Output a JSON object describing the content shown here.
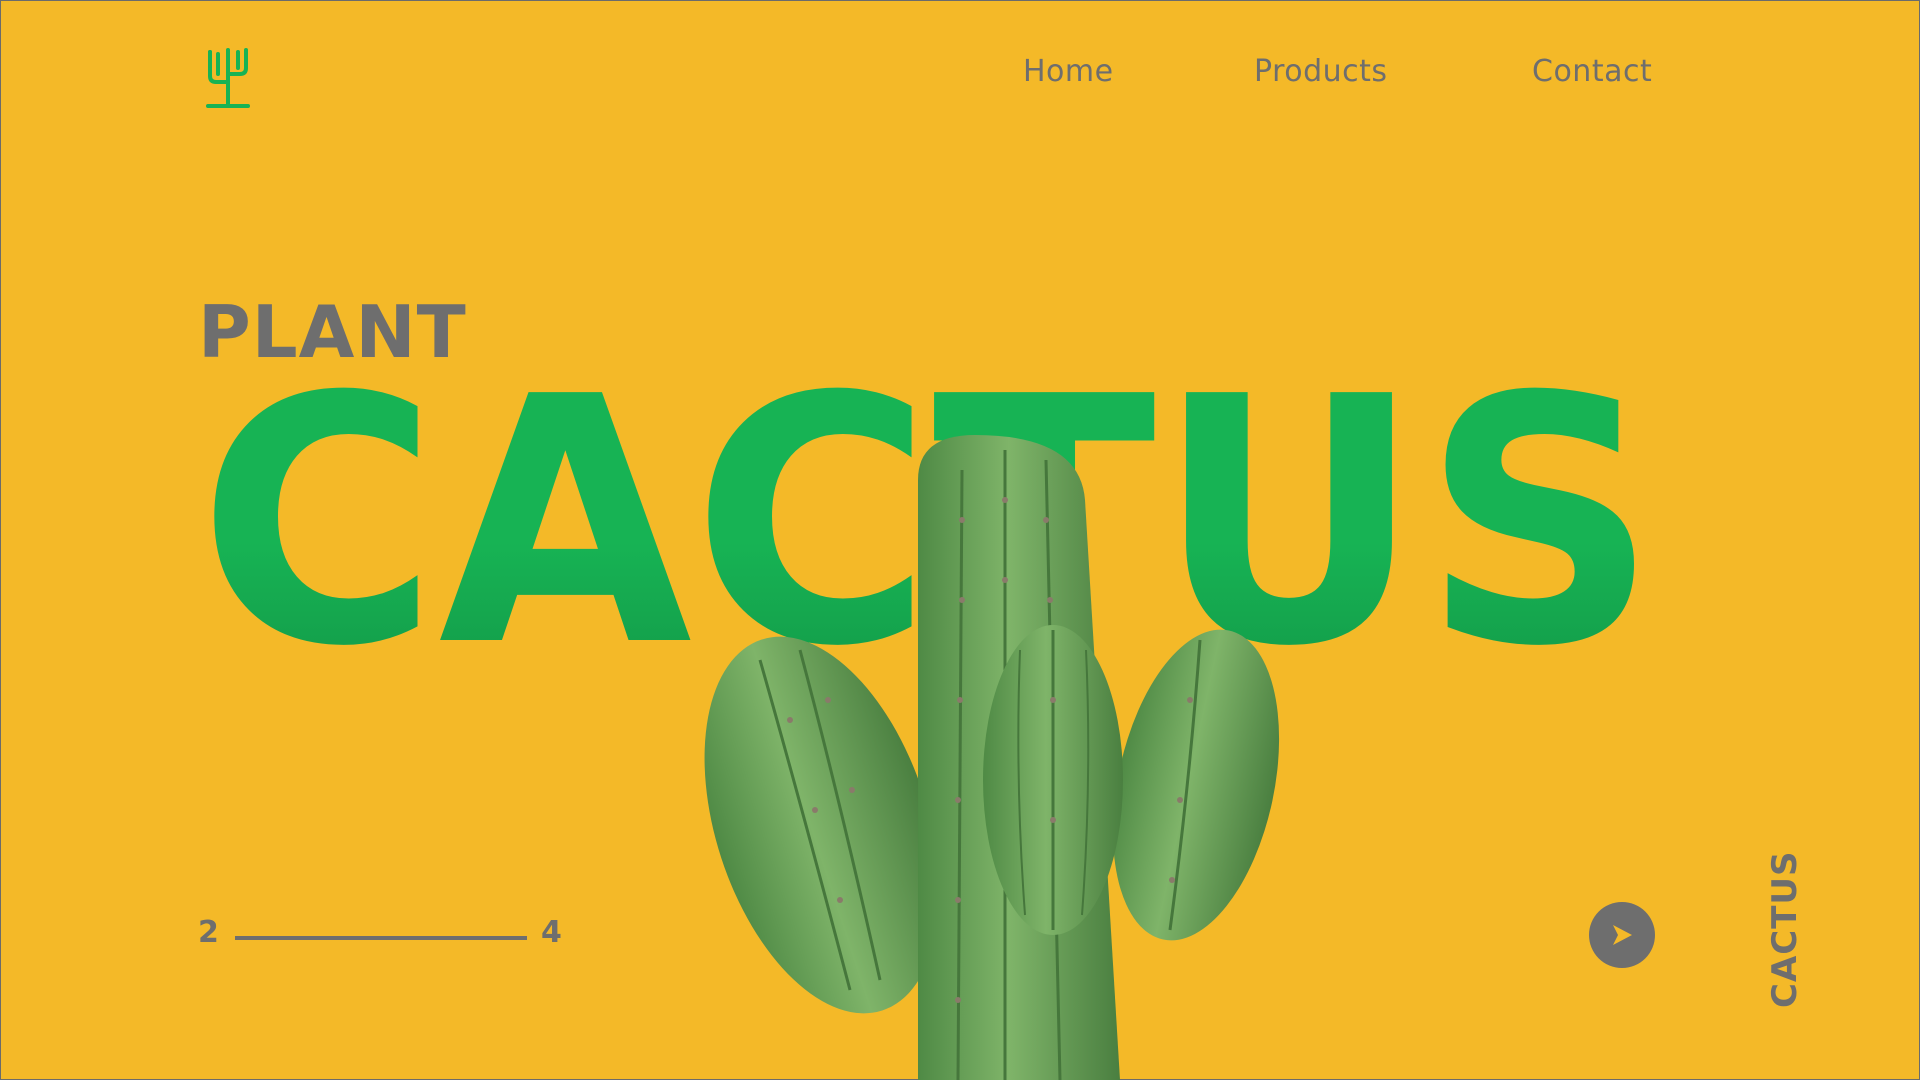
{
  "brand": {
    "logo_icon": "cactus-icon",
    "logo_color": "#17B354"
  },
  "nav": {
    "items": [
      "Home",
      "Products",
      "Contact"
    ]
  },
  "hero": {
    "eyebrow": "PLANT",
    "title": "CACTUS",
    "title_color": "#17B354"
  },
  "pager": {
    "current": "2",
    "total": "4"
  },
  "next_button": {
    "icon": "play-arrow-icon"
  },
  "side_label": "CACTUS",
  "colors": {
    "background": "#F4B928",
    "text": "#6E6E6E",
    "accent": "#17B354",
    "cactus": "#6FA35B"
  }
}
